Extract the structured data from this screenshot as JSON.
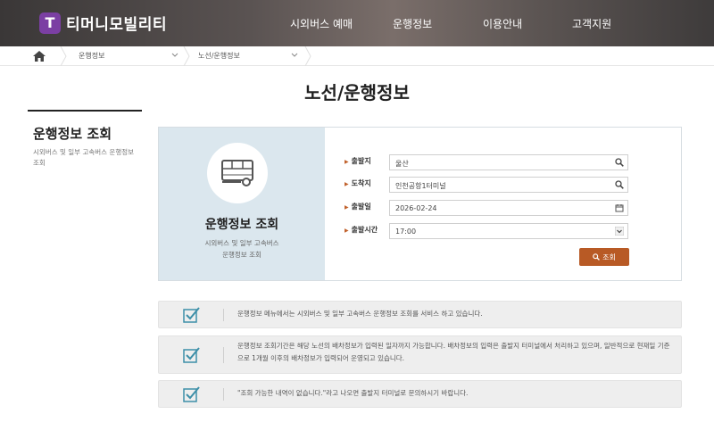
{
  "header": {
    "logo_letter": "T",
    "logo_text": "티머니모빌리티",
    "nav": [
      "시외버스 예매",
      "운행정보",
      "이용안내",
      "고객지원"
    ]
  },
  "breadcrumb": {
    "items": [
      "운행정보",
      "노선/운행정보"
    ]
  },
  "page_title": "노선/운행정보",
  "sidebar": {
    "title": "운행정보 조회",
    "desc": "시외버스 및 일부 고속버스 운행정보 조회"
  },
  "panel": {
    "title": "운행정보 조회",
    "sub_line1": "시외버스 및 일부 고속버스",
    "sub_line2": "운행정보 조회"
  },
  "form": {
    "departure_label": "출발지",
    "departure_value": "울산",
    "arrival_label": "도착지",
    "arrival_value": "인천공항1터미널",
    "date_label": "출발일",
    "date_value": "2026-02-24",
    "time_label": "출발시간",
    "time_value": "17:00",
    "search_label": "조회"
  },
  "notices": [
    "운행정보 메뉴에서는 시외버스 및 일부 고속버스 운행정보 조회를 서비스 하고 있습니다.",
    "운행정보 조회기간은 해당 노선의 배차정보가 입력된 일자까지 가능합니다. 배차정보의 입력은 출발지 터미널에서 처리하고 있으며, 일반적으로 현재일 기준으로 1개월 이후의 배차정보가 입력되어 운영되고 있습니다.",
    "\"조회 가능한 내역이 없습니다.\"라고 나오면 출발지 터미널로 문의하시기 바랍니다."
  ],
  "colors": {
    "accent": "#b85a25",
    "panel_bg": "#dbe7ee",
    "logo": "#7b3fa3",
    "check": "#3d8fa8"
  }
}
